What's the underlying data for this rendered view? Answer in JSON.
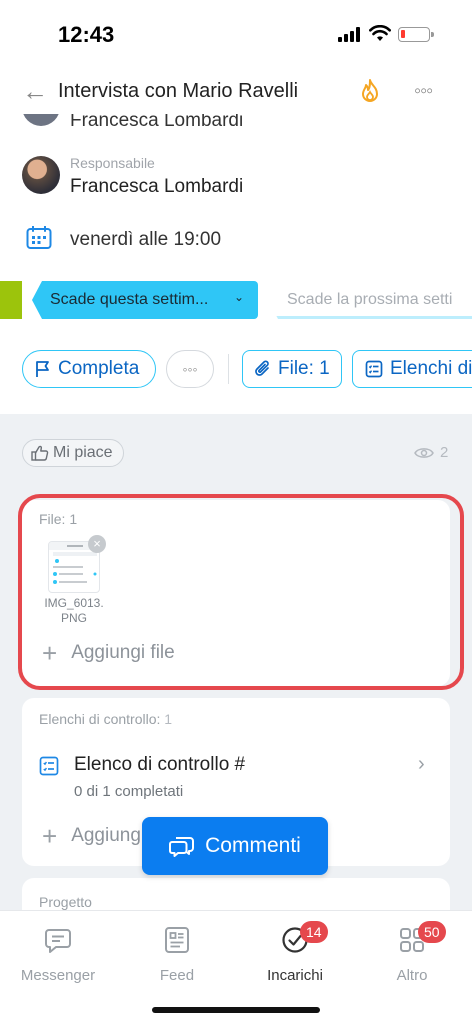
{
  "status_bar": {
    "time": "12:43"
  },
  "header": {
    "title": "Intervista con Mario Ravelli"
  },
  "participant_cut": {
    "name": "Francesca Lombardi"
  },
  "responsible": {
    "label": "Responsabile",
    "name": "Francesca Lombardi"
  },
  "deadline": {
    "text": "venerdì alle 19:00"
  },
  "stages": {
    "current": "Scade questa settim...",
    "next": "Scade la prossima setti"
  },
  "actions": {
    "complete": "Completa",
    "files": "File: 1",
    "checklists": "Elenchi di"
  },
  "likes": {
    "label": "Mi piace",
    "views": "2"
  },
  "files": {
    "label": "File: 1",
    "items": [
      {
        "name": "IMG_6013.\nPNG"
      }
    ],
    "add_label": "Aggiungi file"
  },
  "checklists": {
    "label": "Elenchi di controllo:",
    "count": "1",
    "item_title": "Elenco di controllo #",
    "item_progress": "0 di 1 completati",
    "add_label": "Aggiungi"
  },
  "comments_button": "Commenti",
  "project": {
    "label": "Progetto"
  },
  "bottom_nav": {
    "messenger": "Messenger",
    "feed": "Feed",
    "tasks": "Incarichi",
    "tasks_badge": "14",
    "more": "Altro",
    "more_badge": "50"
  },
  "colors": {
    "accent": "#2fc6f6",
    "link": "#0b66c3",
    "button": "#0b7df0",
    "highlight": "#e5484d",
    "stage_done": "#9cc40c"
  }
}
